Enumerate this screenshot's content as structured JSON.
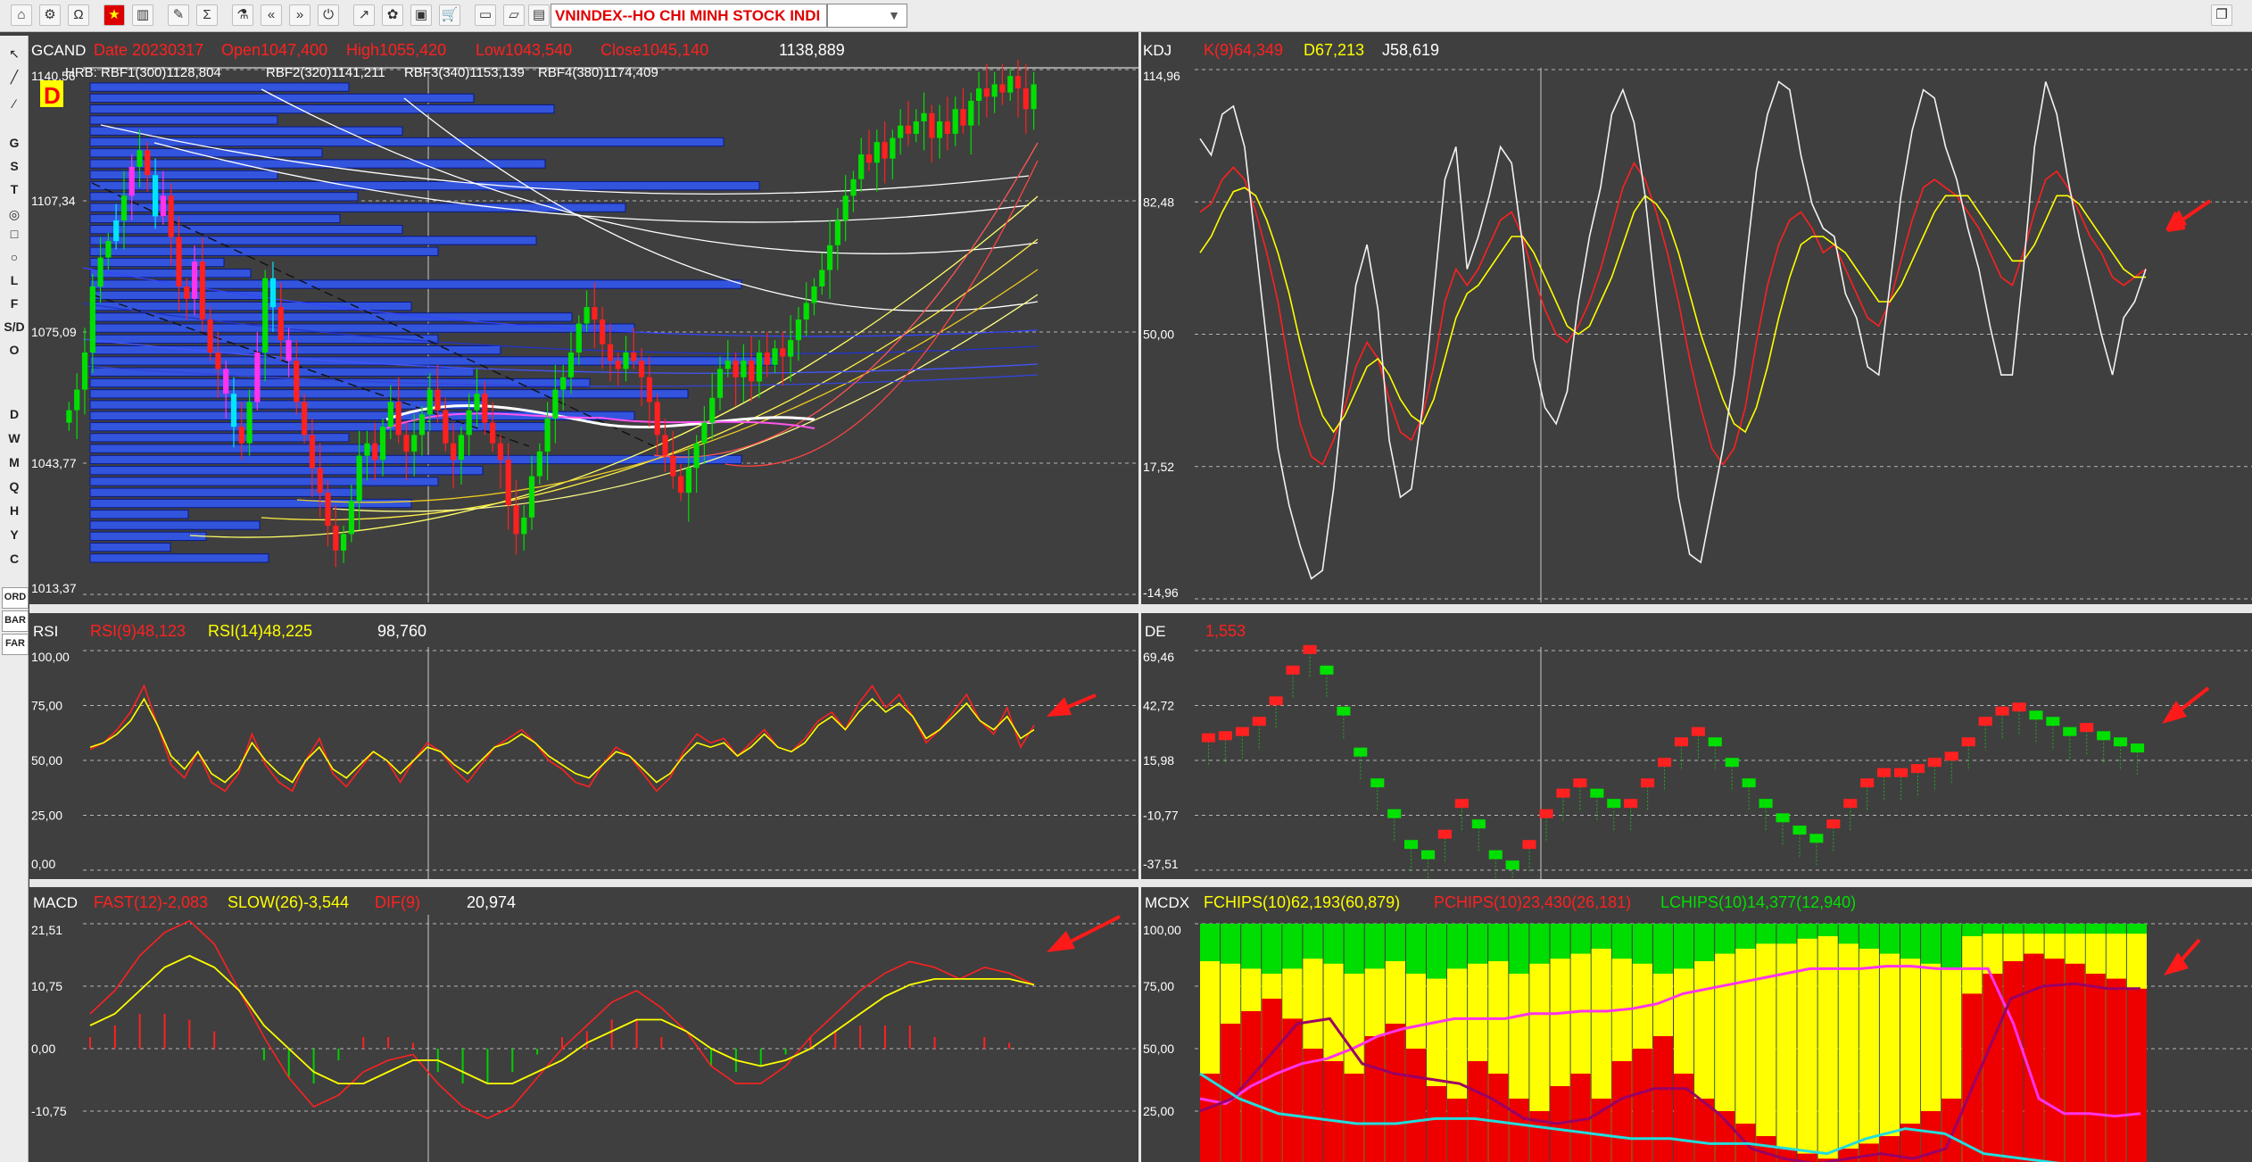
{
  "toolbar": {
    "ticker": "VNINDEX--HO CHI MINH STOCK INDI",
    "icons": [
      "home-icon",
      "chart-config-icon",
      "indicator-icon",
      "vietnam-flag-icon",
      "bar-chart-icon",
      "edit-icon",
      "sum-icon",
      "network-icon",
      "rewind-icon",
      "fast-forward-icon",
      "power-icon",
      "draw-icon",
      "settings-icon",
      "layout-icon",
      "cart-icon",
      "folder-icon",
      "open-folder-icon",
      "monitor-icon",
      "restore-icon"
    ]
  },
  "left_tools": {
    "draw": [
      "G",
      "S",
      "T",
      "L",
      "F",
      "S/D",
      "O"
    ],
    "periods": [
      "D",
      "W",
      "M",
      "Q",
      "H",
      "Y",
      "C"
    ],
    "modes": [
      "ORD",
      "BAR",
      "FAR"
    ]
  },
  "colors": {
    "bg": "#3f3f3f",
    "up": "#00e000",
    "down": "#ff2020",
    "vp": "#3355dd",
    "yellow": "#ffff00",
    "magenta": "#ff33ee"
  },
  "chart_data": [
    {
      "type": "candlestick",
      "name": "GCAND",
      "period_badge": "D",
      "header": {
        "date": "Date 20230317",
        "open": "Open1047,400",
        "high": "High1055,420",
        "low": "Low1043,540",
        "close": "Close1045,140",
        "cursor": "1138,889"
      },
      "rbf": [
        "HRB: RBF1(300)1128,804",
        "RBF2(320)1141,211",
        "RBF3(340)1153,139",
        "RBF4(380)1174,409"
      ],
      "y_ticks": [
        "1140,56",
        "1107,34",
        "1075,09",
        "1043,77",
        "1013,37"
      ],
      "ylim": [
        1013.37,
        1140.56
      ],
      "closes": [
        1058,
        1063,
        1072,
        1088,
        1095,
        1099,
        1104,
        1110,
        1117,
        1121,
        1115,
        1105,
        1110,
        1100,
        1088,
        1085,
        1094,
        1080,
        1072,
        1068,
        1062,
        1054,
        1050,
        1060,
        1072,
        1090,
        1083,
        1075,
        1070,
        1060,
        1052,
        1044,
        1038,
        1030,
        1024,
        1028,
        1036,
        1047,
        1050,
        1046,
        1054,
        1060,
        1052,
        1048,
        1052,
        1057,
        1063,
        1058,
        1050,
        1046,
        1052,
        1058,
        1062,
        1055,
        1050,
        1046,
        1035,
        1028,
        1032,
        1042,
        1048,
        1056,
        1063,
        1066,
        1072,
        1079,
        1083,
        1080,
        1074,
        1070,
        1068,
        1072,
        1070,
        1066,
        1060,
        1052,
        1047,
        1042,
        1038,
        1044,
        1050,
        1055,
        1061,
        1068,
        1070,
        1066,
        1070,
        1065,
        1072,
        1069,
        1073,
        1071,
        1075,
        1080,
        1084,
        1088,
        1092,
        1098,
        1104,
        1110,
        1114,
        1120,
        1118,
        1123,
        1119,
        1124,
        1127,
        1125,
        1128,
        1130,
        1124,
        1128,
        1125,
        1131,
        1127,
        1133,
        1136,
        1134,
        1137,
        1135,
        1139,
        1136,
        1131,
        1137
      ],
      "volume_profile": [
        0.29,
        0.43,
        0.52,
        0.21,
        0.35,
        0.71,
        0.26,
        0.51,
        0.21,
        0.75,
        0.3,
        0.6,
        0.28,
        0.35,
        0.5,
        0.39,
        0.15,
        0.18,
        0.73,
        0.2,
        0.36,
        0.54,
        0.61,
        0.39,
        0.46,
        0.77,
        0.43,
        0.56,
        0.67,
        0.44,
        0.61,
        0.51,
        0.29,
        0.33,
        0.73,
        0.44,
        0.39,
        0.3,
        0.36,
        0.11,
        0.19,
        0.13,
        0.09,
        0.2
      ]
    },
    {
      "type": "line",
      "name": "KDJ",
      "legend": [
        "K(9)64,349",
        "D67,213",
        "J58,619"
      ],
      "y_ticks": [
        "114,96",
        "82,48",
        "50,00",
        "17,52",
        "-14,96"
      ],
      "ylim": [
        -14.96,
        114.96
      ],
      "series": [
        {
          "name": "K(9)64,349",
          "color": "#ff2020",
          "values": [
            80,
            82,
            88,
            91,
            88,
            80,
            70,
            58,
            42,
            28,
            20,
            18,
            24,
            32,
            42,
            48,
            44,
            34,
            26,
            24,
            30,
            42,
            58,
            66,
            62,
            66,
            72,
            78,
            80,
            74,
            64,
            56,
            50,
            48,
            52,
            58,
            66,
            76,
            86,
            92,
            88,
            80,
            70,
            58,
            44,
            32,
            22,
            18,
            22,
            32,
            48,
            62,
            72,
            78,
            80,
            76,
            70,
            72,
            66,
            60,
            54,
            52,
            58,
            68,
            78,
            86,
            88,
            86,
            84,
            80,
            76,
            70,
            64,
            62,
            70,
            80,
            88,
            90,
            86,
            80,
            74,
            70,
            64,
            62,
            64,
            66
          ]
        },
        {
          "name": "D67,213",
          "color": "#ffff00",
          "values": [
            70,
            74,
            80,
            85,
            86,
            84,
            78,
            70,
            60,
            48,
            38,
            30,
            26,
            30,
            36,
            42,
            44,
            40,
            34,
            30,
            28,
            34,
            44,
            54,
            60,
            62,
            66,
            70,
            74,
            74,
            70,
            64,
            58,
            52,
            50,
            52,
            58,
            64,
            72,
            80,
            84,
            82,
            78,
            70,
            60,
            50,
            42,
            34,
            28,
            26,
            32,
            42,
            54,
            64,
            72,
            74,
            74,
            72,
            70,
            66,
            62,
            58,
            58,
            62,
            68,
            74,
            80,
            84,
            84,
            84,
            80,
            76,
            72,
            68,
            68,
            72,
            78,
            84,
            84,
            82,
            78,
            74,
            70,
            66,
            64,
            64
          ]
        },
        {
          "name": "J58,619",
          "color": "#f2f2f2",
          "values": [
            98,
            94,
            104,
            106,
            96,
            72,
            48,
            22,
            8,
            -2,
            -10,
            -8,
            12,
            38,
            62,
            72,
            56,
            24,
            10,
            12,
            32,
            60,
            88,
            96,
            66,
            74,
            84,
            96,
            92,
            72,
            44,
            32,
            28,
            36,
            58,
            74,
            86,
            104,
            110,
            102,
            84,
            58,
            34,
            10,
            -4,
            -6,
            8,
            22,
            40,
            66,
            90,
            104,
            112,
            110,
            94,
            82,
            76,
            74,
            60,
            54,
            42,
            40,
            62,
            84,
            100,
            110,
            108,
            96,
            88,
            76,
            66,
            52,
            40,
            40,
            66,
            96,
            112,
            104,
            88,
            74,
            62,
            50,
            40,
            54,
            58,
            66
          ]
        }
      ]
    },
    {
      "type": "line",
      "name": "RSI",
      "legend": [
        "RSI(9)48,123",
        "RSI(14)48,225",
        "98,760"
      ],
      "y_ticks": [
        "100,00",
        "75,00",
        "50,00",
        "25,00",
        "0,00"
      ],
      "ylim": [
        0,
        100
      ],
      "series": [
        {
          "name": "RSI(9)48,123",
          "color": "#ff2020",
          "values": [
            55,
            58,
            64,
            72,
            84,
            66,
            48,
            42,
            54,
            40,
            36,
            44,
            62,
            48,
            40,
            36,
            50,
            60,
            44,
            38,
            46,
            54,
            50,
            40,
            50,
            58,
            54,
            46,
            40,
            48,
            56,
            60,
            64,
            58,
            50,
            46,
            40,
            38,
            48,
            56,
            52,
            44,
            36,
            42,
            54,
            62,
            58,
            60,
            52,
            58,
            64,
            56,
            54,
            60,
            68,
            72,
            64,
            76,
            84,
            74,
            80,
            70,
            58,
            64,
            72,
            80,
            68,
            62,
            74,
            56,
            66
          ]
        },
        {
          "name": "RSI(14)48,225",
          "color": "#ffff00",
          "values": [
            56,
            58,
            62,
            68,
            78,
            66,
            52,
            46,
            54,
            44,
            40,
            46,
            58,
            50,
            44,
            40,
            50,
            56,
            46,
            42,
            48,
            54,
            50,
            44,
            50,
            56,
            54,
            48,
            44,
            50,
            56,
            58,
            62,
            58,
            52,
            48,
            44,
            42,
            48,
            54,
            52,
            46,
            40,
            44,
            52,
            58,
            56,
            58,
            52,
            56,
            62,
            56,
            54,
            58,
            66,
            70,
            64,
            72,
            78,
            72,
            76,
            70,
            60,
            64,
            70,
            76,
            68,
            64,
            70,
            60,
            64
          ]
        }
      ]
    },
    {
      "type": "bar",
      "name": "DE",
      "legend": [
        "1,553"
      ],
      "y_ticks": [
        "69,46",
        "42,72",
        "15,98",
        "-10,77",
        "-37,51"
      ],
      "ylim": [
        -37.51,
        69.46
      ],
      "values": [
        27,
        28,
        30,
        35,
        45,
        60,
        70,
        60,
        40,
        20,
        5,
        -10,
        -25,
        -30,
        -20,
        -5,
        -15,
        -30,
        -35,
        -25,
        -10,
        0,
        5,
        0,
        -5,
        -5,
        5,
        15,
        25,
        30,
        25,
        15,
        5,
        -5,
        -12,
        -18,
        -22,
        -15,
        -5,
        5,
        10,
        10,
        12,
        15,
        18,
        25,
        35,
        40,
        42,
        38,
        35,
        30,
        32,
        28,
        25,
        22
      ]
    },
    {
      "type": "line",
      "name": "MACD",
      "legend": [
        "FAST(12)-2,083",
        "SLOW(26)-3,544",
        "DIF(9)",
        "20,974"
      ],
      "y_ticks": [
        "21,51",
        "10,75",
        "0,00",
        "-10,75",
        "-21,51"
      ],
      "ylim": [
        -21.51,
        21.51
      ],
      "series": [
        {
          "name": "FAST(12)-2,083",
          "color": "#ff2020",
          "values": [
            6,
            10,
            16,
            20,
            22,
            18,
            10,
            2,
            -5,
            -10,
            -8,
            -4,
            -2,
            -1,
            -6,
            -10,
            -12,
            -10,
            -5,
            0,
            4,
            8,
            10,
            7,
            3,
            -3,
            -6,
            -6,
            -3,
            2,
            6,
            10,
            13,
            15,
            14,
            12,
            14,
            13,
            11
          ]
        },
        {
          "name": "SLOW(26)-3,544",
          "color": "#ffff00",
          "values": [
            4,
            6,
            10,
            14,
            16,
            14,
            10,
            4,
            0,
            -4,
            -6,
            -6,
            -4,
            -2,
            -2,
            -4,
            -6,
            -6,
            -4,
            -2,
            1,
            3,
            5,
            5,
            3,
            0,
            -2,
            -3,
            -2,
            0,
            3,
            6,
            9,
            11,
            12,
            12,
            12,
            12,
            11
          ]
        },
        {
          "name": "DIF(9)",
          "color": "#ff2020",
          "values": [
            2,
            4,
            6,
            6,
            5,
            3,
            0,
            -2,
            -5,
            -6,
            -2,
            2,
            2,
            1,
            -4,
            -6,
            -6,
            -4,
            -1,
            2,
            3,
            5,
            5,
            2,
            0,
            -3,
            -4,
            -3,
            -1,
            2,
            3,
            4,
            4,
            4,
            2,
            0,
            2,
            1,
            0
          ]
        }
      ]
    },
    {
      "type": "area",
      "name": "MCDX",
      "legend": [
        "FCHIPS(10)62,193(60,879)",
        "PCHIPS(10)23,430(26,181)",
        "LCHIPS(10)14,377(12,940)"
      ],
      "y_ticks": [
        "100,00",
        "75,00",
        "50,00",
        "25,00",
        "0,00"
      ],
      "ylim": [
        0,
        100
      ],
      "series": [
        {
          "name": "PCHIPS(10)23,430(26,181)",
          "color": "#ff0000",
          "values": [
            40,
            60,
            65,
            70,
            62,
            50,
            45,
            40,
            55,
            60,
            50,
            35,
            30,
            45,
            40,
            30,
            25,
            35,
            40,
            30,
            45,
            50,
            55,
            40,
            30,
            25,
            20,
            15,
            10,
            8,
            6,
            10,
            12,
            15,
            20,
            25,
            30,
            72,
            80,
            85,
            88,
            86,
            84,
            80,
            78,
            74
          ]
        },
        {
          "name": "FCHIPS(10)62,193(60,879)",
          "color": "#ffff00",
          "values": [
            85,
            84,
            82,
            80,
            82,
            86,
            84,
            80,
            82,
            85,
            80,
            78,
            82,
            84,
            85,
            80,
            84,
            86,
            88,
            90,
            86,
            84,
            80,
            82,
            85,
            88,
            90,
            92,
            92,
            94,
            95,
            92,
            90,
            88,
            86,
            84,
            82,
            95,
            96,
            96,
            96,
            96,
            96,
            96,
            96,
            96
          ]
        },
        {
          "name": "magenta",
          "color": "#ff33ee",
          "values": [
            30,
            28,
            35,
            40,
            44,
            46,
            50,
            55,
            58,
            60,
            62,
            62,
            62,
            64,
            64,
            65,
            65,
            66,
            68,
            72,
            74,
            76,
            78,
            80,
            82,
            82,
            82,
            83,
            83,
            82,
            82,
            82,
            60,
            30,
            24,
            24,
            23,
            24
          ]
        },
        {
          "name": "purple",
          "color": "#990066",
          "values": [
            25,
            30,
            45,
            60,
            62,
            44,
            40,
            38,
            36,
            30,
            22,
            20,
            22,
            30,
            34,
            34,
            24,
            10,
            6,
            4,
            6,
            8,
            6,
            10,
            40,
            70,
            75,
            76,
            74,
            74
          ]
        },
        {
          "name": "cyan",
          "color": "#22dddd",
          "values": [
            40,
            30,
            24,
            22,
            20,
            20,
            22,
            22,
            20,
            18,
            16,
            14,
            14,
            12,
            12,
            10,
            8,
            14,
            18,
            16,
            8,
            6,
            4,
            2,
            2
          ]
        }
      ]
    }
  ]
}
